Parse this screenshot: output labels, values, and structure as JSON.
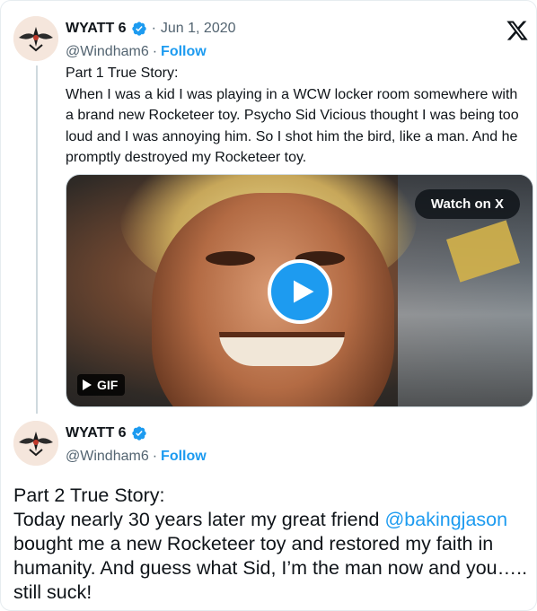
{
  "tweet1": {
    "author_name": "WYATT 6",
    "handle": "@Windham6",
    "separator": "·",
    "follow_label": "Follow",
    "date": "Jun 1, 2020",
    "lines": [
      "Part 1 True Story:",
      "When I was a kid I was playing in a WCW locker room somewhere with a brand new Rocketeer toy. Psycho Sid Vicious thought I was being too loud and I was annoying him. So I shot him the bird, like a man. And he promptly destroyed my Rocketeer toy."
    ],
    "media": {
      "watch_label": "Watch on X",
      "gif_label": "GIF"
    }
  },
  "tweet2": {
    "author_name": "WYATT 6",
    "handle": "@Windham6",
    "separator": "·",
    "follow_label": "Follow",
    "line1": "Part 2 True Story:",
    "line2_before": "Today nearly 30 years later my great friend ",
    "mention": "@bakingjason",
    "line2_after": " bought me a new Rocketeer toy and restored my faith in humanity. And guess what Sid, I’m the man now and you….. still suck!"
  },
  "icons": {
    "verified": "verified-badge-icon",
    "logo": "x-logo-icon",
    "play": "play-icon"
  },
  "colors": {
    "accent": "#1d9bf0",
    "text": "#0f1419",
    "muted": "#536471",
    "thread_line": "#cfd9de"
  }
}
